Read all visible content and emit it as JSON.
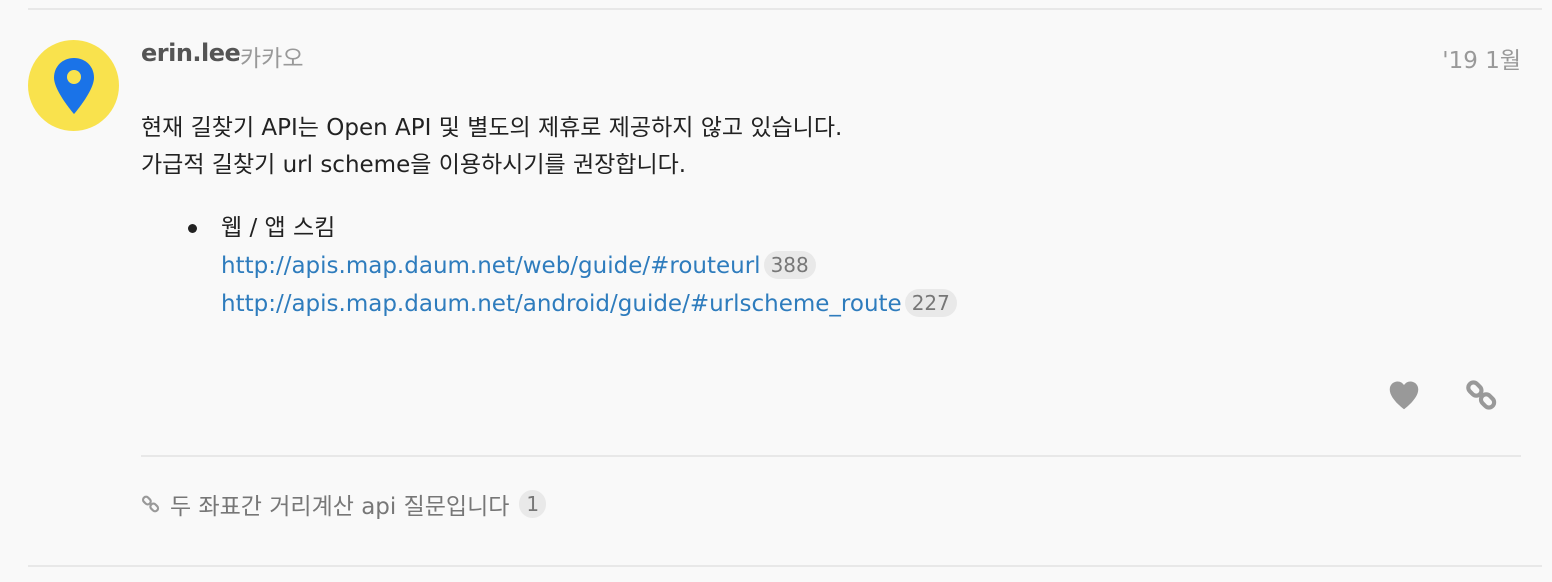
{
  "post": {
    "username": "erin.lee",
    "fullname": "카카오",
    "date": "'19 1월",
    "paragraphs": [
      "현재 길찾기 API는 Open API 및 별도의 제휴로 제공하지 않고 있습니다.",
      "가급적 길찾기 url scheme을 이용하시기를 권장합니다."
    ],
    "bullet": {
      "label": "웹 / 앱 스킴",
      "links": [
        {
          "url": "http://apis.map.daum.net/web/guide/#routeurl",
          "count": "388"
        },
        {
          "url": "http://apis.map.daum.net/android/guide/#urlscheme_route",
          "count": "227"
        }
      ]
    },
    "actions": {
      "like_icon": "heart-icon",
      "link_icon": "link-icon"
    }
  },
  "linked_topic": {
    "icon": "link-icon",
    "title": "두 좌표간 거리계산 api 질문입니다",
    "count": "1"
  },
  "colors": {
    "avatar_bg": "#f9e24d",
    "pin": "#1a73e8",
    "link": "#2e7cbd",
    "muted": "#999999"
  }
}
